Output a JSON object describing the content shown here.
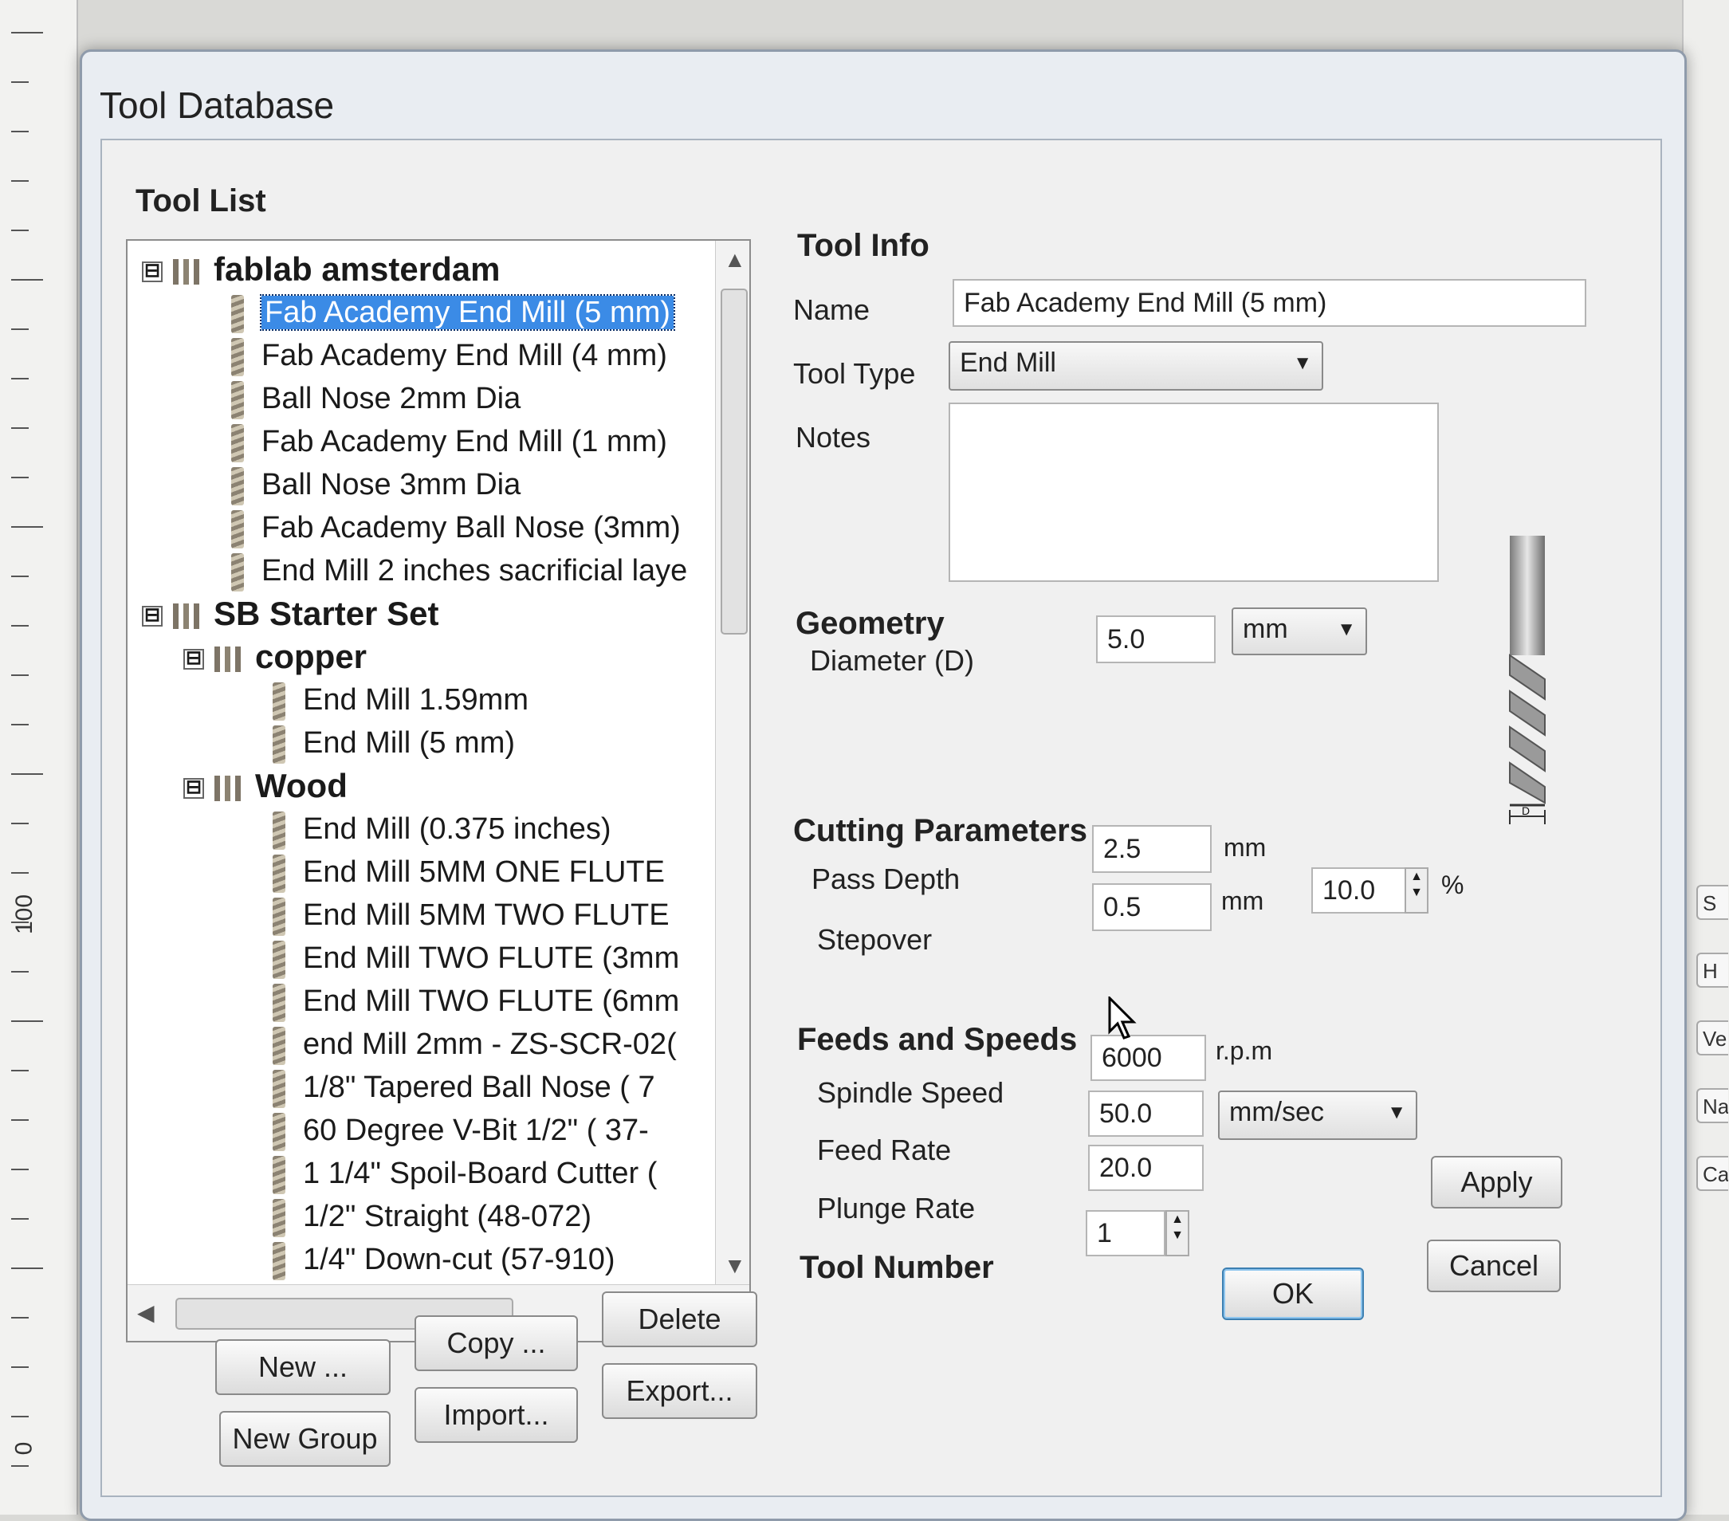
{
  "dialog": {
    "title": "Tool Database"
  },
  "tool_list": {
    "label": "Tool List",
    "rows": [
      {
        "text": "fablab amsterdam",
        "kind": "group",
        "level": 0,
        "expander": "⊟"
      },
      {
        "text": "Fab Academy End Mill (5 mm)",
        "kind": "tool",
        "level": 1,
        "selected": true
      },
      {
        "text": "Fab Academy End Mill (4 mm)",
        "kind": "tool",
        "level": 1
      },
      {
        "text": "Ball Nose 2mm Dia",
        "kind": "tool",
        "level": 1
      },
      {
        "text": "Fab Academy End Mill (1 mm)",
        "kind": "tool",
        "level": 1
      },
      {
        "text": "Ball Nose 3mm Dia",
        "kind": "tool",
        "level": 1
      },
      {
        "text": "Fab Academy Ball Nose (3mm)",
        "kind": "tool",
        "level": 1
      },
      {
        "text": "End Mill 2 inches sacrificial laye",
        "kind": "tool",
        "level": 1
      },
      {
        "text": "SB Starter Set",
        "kind": "group",
        "level": 0,
        "expander": "⊟"
      },
      {
        "text": "copper",
        "kind": "group",
        "level": 1,
        "expander": "⊟"
      },
      {
        "text": "End Mill 1.59mm",
        "kind": "tool",
        "level": 2
      },
      {
        "text": "End Mill (5 mm)",
        "kind": "tool",
        "level": 2
      },
      {
        "text": "Wood",
        "kind": "group",
        "level": 1,
        "expander": "⊟"
      },
      {
        "text": "End Mill (0.375 inches)",
        "kind": "tool",
        "level": 2
      },
      {
        "text": "End Mill 5MM ONE FLUTE",
        "kind": "tool",
        "level": 2
      },
      {
        "text": "End Mill 5MM TWO FLUTE",
        "kind": "tool",
        "level": 2
      },
      {
        "text": "End Mill TWO FLUTE (3mm",
        "kind": "tool",
        "level": 2
      },
      {
        "text": "End Mill TWO FLUTE (6mm",
        "kind": "tool",
        "level": 2
      },
      {
        "text": "end Mill 2mm - ZS-SCR-02(",
        "kind": "tool",
        "level": 2
      },
      {
        "text": "1/8\" Tapered Ball Nose ( 7",
        "kind": "tool",
        "level": 2
      },
      {
        "text": "60 Degree V-Bit 1/2\" ( 37-",
        "kind": "tool",
        "level": 2
      },
      {
        "text": "1 1/4\" Spoil-Board Cutter (",
        "kind": "tool",
        "level": 2
      },
      {
        "text": "1/2\" Straight (48-072)",
        "kind": "tool",
        "level": 2
      },
      {
        "text": "1/4\" Down-cut (57-910)",
        "kind": "tool",
        "level": 2
      }
    ],
    "buttons": {
      "new": "New ...",
      "copy": "Copy ...",
      "delete": "Delete",
      "new_group": "New Group",
      "import": "Import...",
      "export": "Export..."
    }
  },
  "tool_info": {
    "label": "Tool Info",
    "name_label": "Name",
    "name_value": "Fab Academy End Mill (5 mm)",
    "type_label": "Tool Type",
    "type_value": "End Mill",
    "notes_label": "Notes",
    "notes_value": ""
  },
  "geometry": {
    "label": "Geometry",
    "diameter_label": "Diameter (D)",
    "diameter_value": "5.0",
    "units_value": "mm",
    "diagram_label": "D"
  },
  "cutting": {
    "label": "Cutting Parameters",
    "pass_depth_label": "Pass Depth",
    "pass_depth_value": "2.5",
    "pass_depth_unit": "mm",
    "stepover_label": "Stepover",
    "stepover_value": "0.5",
    "stepover_unit": "mm",
    "stepover_percent": "10.0",
    "percent_sign": "%"
  },
  "feeds": {
    "label": "Feeds and Speeds",
    "spindle_label": "Spindle Speed",
    "spindle_value": "6000",
    "spindle_unit": "r.p.m",
    "feed_label": "Feed Rate",
    "feed_value": "50.0",
    "rate_unit": "mm/sec",
    "plunge_label": "Plunge Rate",
    "plunge_value": "20.0"
  },
  "tool_number": {
    "label": "Tool Number",
    "value": "1"
  },
  "actions": {
    "apply": "Apply",
    "ok": "OK",
    "cancel": "Cancel"
  },
  "background": {
    "ruler_label_top": "100",
    "ruler_label_bottom": "0",
    "right_stubs": [
      "S",
      "H",
      "Ve",
      "Na",
      "Ca"
    ]
  }
}
